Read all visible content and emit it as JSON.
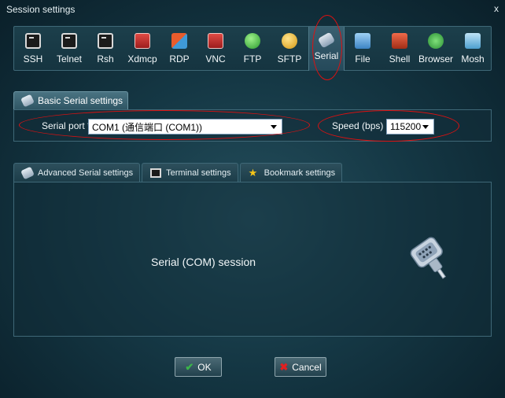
{
  "window": {
    "title": "Session settings",
    "close_label": "x"
  },
  "protocols": [
    {
      "label": "SSH",
      "icon": "ssh-icon"
    },
    {
      "label": "Telnet",
      "icon": "telnet-icon"
    },
    {
      "label": "Rsh",
      "icon": "rsh-icon"
    },
    {
      "label": "Xdmcp",
      "icon": "xdmcp-icon"
    },
    {
      "label": "RDP",
      "icon": "rdp-icon"
    },
    {
      "label": "VNC",
      "icon": "vnc-icon"
    },
    {
      "label": "FTP",
      "icon": "ftp-icon"
    },
    {
      "label": "SFTP",
      "icon": "sftp-icon"
    },
    {
      "label": "Serial",
      "icon": "serial-icon",
      "selected": true
    },
    {
      "label": "File",
      "icon": "file-icon"
    },
    {
      "label": "Shell",
      "icon": "shell-icon"
    },
    {
      "label": "Browser",
      "icon": "browser-icon"
    },
    {
      "label": "Mosh",
      "icon": "mosh-icon"
    }
  ],
  "basic": {
    "tab_label": "Basic Serial settings",
    "serial_port_label": "Serial port *",
    "serial_port_value": "COM1  (通信端口 (COM1))",
    "speed_label": "Speed (bps) *",
    "speed_value": "115200"
  },
  "advanced_tabs": [
    {
      "label": "Advanced Serial settings",
      "icon": "serial-icon"
    },
    {
      "label": "Terminal settings",
      "icon": "terminal-icon"
    },
    {
      "label": "Bookmark settings",
      "icon": "star-icon"
    }
  ],
  "session": {
    "text": "Serial (COM) session"
  },
  "buttons": {
    "ok": "OK",
    "cancel": "Cancel"
  },
  "colors": {
    "annotation": "#e01010",
    "accent_ok": "#3bb54a",
    "accent_cancel": "#e02020"
  }
}
